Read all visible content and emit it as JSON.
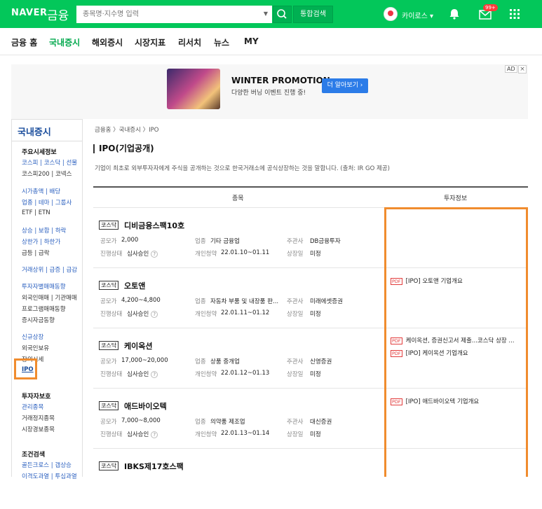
{
  "header": {
    "logo": "NAVER",
    "logo_sub": "금융",
    "search_placeholder": "종목명·지수명 입력",
    "search_button_label": "통합검색",
    "user_name": "카이로스 ▾",
    "mail_badge": "99+"
  },
  "nav": {
    "tabs": [
      "금융 홈",
      "국내증시",
      "해외증시",
      "시장지표",
      "리서치",
      "뉴스",
      "MY"
    ],
    "active": "국내증시"
  },
  "ad": {
    "title": "WINTER PROMOTION",
    "desc": "다양한 버닝 이벤트 진행 중!",
    "button": "더 알아보기 ›",
    "label": "AD",
    "close": "×"
  },
  "sidebar": {
    "title": "국내증시",
    "sections": [
      {
        "head": "주요시세정보",
        "lines": [
          "코스피 | 코스닥 | 선물",
          "코스피200 | 코넥스"
        ]
      },
      {
        "lines": [
          "시가총액 | 배당",
          "업종 | 테마 | 그룹사",
          "ETF | ETN"
        ]
      },
      {
        "lines": [
          "상승 | 보합 | 하락",
          "상한가 | 하한가",
          "급등 | 급락"
        ]
      },
      {
        "lines": [
          "거래상위 | 급증 | 급감"
        ]
      },
      {
        "lines": [
          "투자자별매매동향",
          "외국인매매 | 기관매매",
          "프로그램매매동향",
          "증시자금동향"
        ]
      },
      {
        "lines": [
          "신규상장",
          "외국인보유",
          "장외시세",
          "IPO"
        ]
      },
      {
        "head": "투자자보호",
        "lines": [
          "관리종목",
          "거래정지종목",
          "시장경보종목"
        ]
      },
      {
        "head": "조건검색",
        "lines": [
          "골든크로스 | 갭상승",
          "이격도과열 | 투심과열"
        ]
      }
    ]
  },
  "content": {
    "breadcrumb": "금융홈 〉국내증시 〉IPO",
    "title": "IPO(기업공개)",
    "description": "기업이 최초로 외부투자자에게 주식을 공개하는 것으로 한국거래소에 공식상장하는 것을 말합니다. (출처: IR GO 제공)",
    "columns": [
      "종목",
      "투자정보"
    ],
    "labels": {
      "price": "공모가",
      "industry": "업종",
      "lead": "주관사",
      "status": "진행상태",
      "subscription": "개인청약",
      "listing": "상장일"
    },
    "rows": [
      {
        "market": "코스닥",
        "name": "디비금융스팩10호",
        "price": "2,000",
        "industry": "기타 금융업",
        "lead": "DB금융투자",
        "status": "심사승인",
        "subscription": "22.01.10~01.11",
        "listing": "미정",
        "docs": []
      },
      {
        "market": "코스닥",
        "name": "오토앤",
        "price": "4,200~4,800",
        "industry": "자동차 부품 및 내장품 판...",
        "lead": "미래에셋증권",
        "status": "심사승인",
        "subscription": "22.01.11~01.12",
        "listing": "미정",
        "docs": [
          "[IPO] 오토앤 기업개요"
        ]
      },
      {
        "market": "코스닥",
        "name": "케이옥션",
        "price": "17,000~20,000",
        "industry": "상품 중개업",
        "lead": "신영증권",
        "status": "심사승인",
        "subscription": "22.01.12~01.13",
        "listing": "미정",
        "docs": [
          "케이옥션, 증권신고서 제출...코스닥 상장 ...",
          "[IPO] 케이옥션 기업개요"
        ]
      },
      {
        "market": "코스닥",
        "name": "애드바이오텍",
        "price": "7,000~8,000",
        "industry": "의약품 제조업",
        "lead": "대신증권",
        "status": "심사승인",
        "subscription": "22.01.13~01.14",
        "listing": "미정",
        "docs": [
          "[IPO] 애드바이오텍 기업개요"
        ]
      },
      {
        "market": "코스닥",
        "name": "IBKS제17호스팩"
      }
    ],
    "pdf_tag": "PDF",
    "help": "?"
  }
}
